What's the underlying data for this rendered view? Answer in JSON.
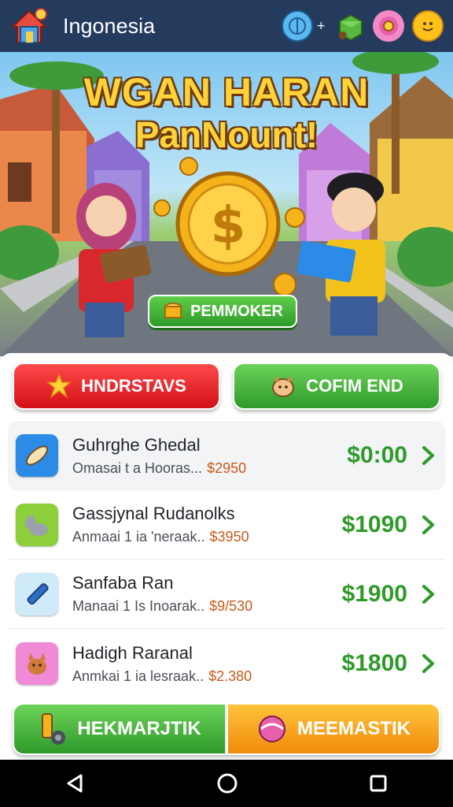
{
  "app": {
    "title": "Ingonesia"
  },
  "banner": {
    "line1": "WGAN HARAN",
    "line2": "PanNount!",
    "button_label": "PEMMOKER"
  },
  "actions": {
    "left_label": "HNDRSTAVS",
    "right_label": "COFIM END"
  },
  "items": [
    {
      "name": "Guhrghe Ghedal",
      "desc": "Omasai t a Hooras...",
      "price": "$2950",
      "amount": "$0:00",
      "icon": "surfboard-icon",
      "thumb_color": "#2b8be6"
    },
    {
      "name": "Gassjynal Rudanolks",
      "desc": "Anmaai 1 ia 'neraak..",
      "price": "$3950",
      "amount": "$1090",
      "icon": "cat-icon",
      "thumb_color": "#8ccf3a"
    },
    {
      "name": "Sanfaba Ran",
      "desc": "Manaai 1 Is Inoarak..",
      "price": "$9/530",
      "amount": "$1900",
      "icon": "pen-icon",
      "thumb_color": "#7cc7ef"
    },
    {
      "name": "Hadigh Raranal",
      "desc": "Anmkai 1 ia lesraak..",
      "price": "$2.380",
      "amount": "$1800",
      "icon": "dog-icon",
      "thumb_color": "#f08ad6"
    }
  ],
  "bottom": {
    "left_label": "HEKMARJTIK",
    "right_label": "MEEMASTIK"
  },
  "colors": {
    "topbar": "#243b5e",
    "green": "#2f9a2a",
    "red": "#d20f18",
    "orange": "#f08a0c",
    "price": "#c75a1a"
  }
}
